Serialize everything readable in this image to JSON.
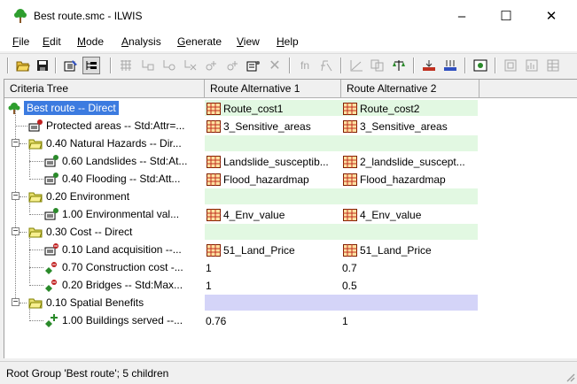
{
  "window": {
    "title": "Best route.smc - ILWIS",
    "minimize": "–",
    "maximize": "☐",
    "close": "✕"
  },
  "menu": [
    {
      "key": "F",
      "rest": "ile"
    },
    {
      "key": "E",
      "rest": "dit"
    },
    {
      "key": "M",
      "rest": "ode"
    },
    {
      "key": "A",
      "rest": "nalysis"
    },
    {
      "key": "G",
      "rest": "enerate"
    },
    {
      "key": "V",
      "rest": "iew"
    },
    {
      "key": "H",
      "rest": "elp"
    }
  ],
  "toolbar": {
    "fn_label": "fn"
  },
  "columns": [
    "Criteria Tree",
    "Route Alternative 1",
    "Route Alternative 2"
  ],
  "rows": [
    {
      "label": "Best route -- Direct",
      "c1": "Route_cost1",
      "c2": "Route_cost2"
    },
    {
      "label": "Protected areas -- Std:Attr=...",
      "c1": "3_Sensitive_areas",
      "c2": "3_Sensitive_areas"
    },
    {
      "label": "0.40 Natural Hazards -- Dir...",
      "c1": "",
      "c2": ""
    },
    {
      "label": "0.60 Landslides -- Std:At...",
      "c1": "Landslide_susceptib...",
      "c2": "2_landslide_suscept..."
    },
    {
      "label": "0.40 Flooding -- Std:Att...",
      "c1": "Flood_hazardmap",
      "c2": "Flood_hazardmap"
    },
    {
      "label": "0.20 Environment",
      "c1": "",
      "c2": ""
    },
    {
      "label": "1.00 Environmental val...",
      "c1": "4_Env_value",
      "c2": "4_Env_value"
    },
    {
      "label": "0.30 Cost -- Direct",
      "c1": "",
      "c2": ""
    },
    {
      "label": "0.10 Land acquisition --...",
      "c1": "51_Land_Price",
      "c2": "51_Land_Price"
    },
    {
      "label": "0.70 Construction cost -...",
      "c1": "1",
      "c2": "0.7"
    },
    {
      "label": "0.20 Bridges -- Std:Max...",
      "c1": "1",
      "c2": "0.5"
    },
    {
      "label": "0.10 Spatial Benefits",
      "c1": "",
      "c2": ""
    },
    {
      "label": "1.00 Buildings served --...",
      "c1": "0.76",
      "c2": "1"
    }
  ],
  "status": "Root Group 'Best route'; 5 children"
}
